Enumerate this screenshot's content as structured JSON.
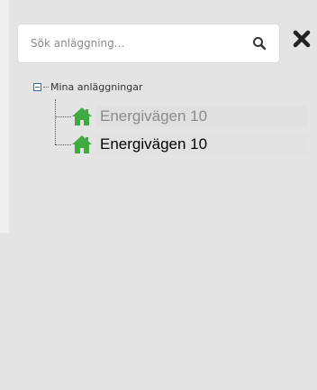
{
  "search": {
    "placeholder": "Sök anläggning...",
    "icon": "search-icon"
  },
  "close": {
    "icon": "close-icon"
  },
  "tree": {
    "root_label": "Mina anläggningar",
    "items": [
      {
        "label": "Energivägen 10",
        "icon": "house-icon",
        "state": "dimmed"
      },
      {
        "label": "Energivägen 10",
        "icon": "house-icon",
        "state": "normal"
      }
    ]
  },
  "colors": {
    "house": "#3faa3f",
    "toggle": "#2f6fa8",
    "background": "#e4e4e4"
  }
}
